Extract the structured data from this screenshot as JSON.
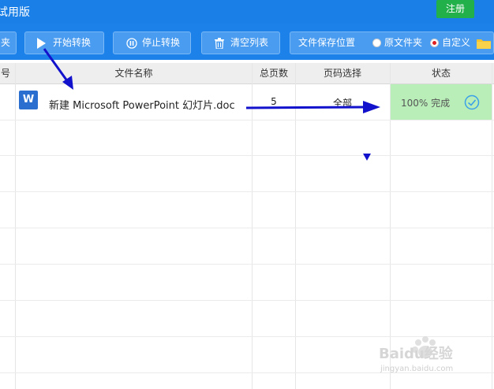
{
  "title": "试用版",
  "register_button": "注册",
  "toolbar": {
    "partial_left_label": "夹",
    "start_label": "开始转换",
    "stop_label": "停止转换",
    "clear_label": "清空列表",
    "save_location_label": "文件保存位置",
    "option_original": "原文件夹",
    "option_custom": "自定义",
    "selected_option": "自定义"
  },
  "table": {
    "headers": [
      "号",
      "文件名称",
      "总页数",
      "页码选择",
      "状态"
    ],
    "rows": [
      {
        "icon": "W",
        "file_name": "新建 Microsoft PowerPoint 幻灯片.doc",
        "total_pages": "5",
        "page_selection": "全部",
        "status": "100% 完成"
      }
    ]
  },
  "watermark": {
    "brand": "Baidu经验",
    "url": "jingyan.baidu.com"
  },
  "colors": {
    "titlebar": "#1a7fe6",
    "toolbar": "#1c82ea",
    "register": "#22b04a",
    "status_done_bg": "#b9eeb9",
    "annotation_arrow": "#1212cc"
  }
}
